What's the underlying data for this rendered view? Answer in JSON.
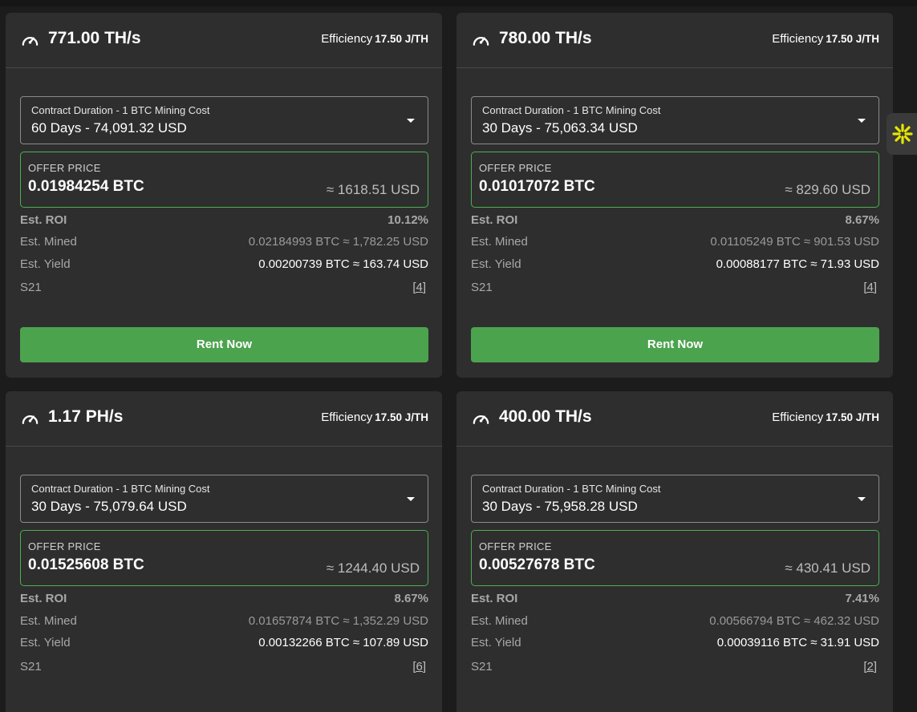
{
  "colors": {
    "accent_green": "#4ca34e",
    "card_bg": "#2e2e2e",
    "page_bg": "#1c1c1c",
    "widget_icon": "#e6e600"
  },
  "icons": {
    "hashrate": "speedometer-icon",
    "select": "caret-down-icon",
    "widget": "sparkle-icon"
  },
  "cards": [
    {
      "hashrate": "771.00 TH/s",
      "efficiency_label": "Efficiency",
      "efficiency_value": "17.50 J/TH",
      "select_label": "Contract Duration - 1 BTC Mining Cost",
      "select_value": "60 Days - 74,091.32 USD",
      "offer_label": "OFFER PRICE",
      "offer_btc": "0.01984254 BTC",
      "offer_usd": "≈ 1618.51 USD",
      "roi_label": "Est. ROI",
      "roi_value": "10.12%",
      "mined_label": "Est. Mined",
      "mined_value": "0.02184993 BTC ≈ 1,782.25 USD",
      "yield_label": "Est. Yield",
      "yield_value": "0.00200739 BTC ≈ 163.74 USD",
      "model": "S21",
      "model_count": "[4]",
      "button": "Rent Now"
    },
    {
      "hashrate": "780.00 TH/s",
      "efficiency_label": "Efficiency",
      "efficiency_value": "17.50 J/TH",
      "select_label": "Contract Duration - 1 BTC Mining Cost",
      "select_value": "30 Days - 75,063.34 USD",
      "offer_label": "OFFER PRICE",
      "offer_btc": "0.01017072 BTC",
      "offer_usd": "≈ 829.60 USD",
      "roi_label": "Est. ROI",
      "roi_value": "8.67%",
      "mined_label": "Est. Mined",
      "mined_value": "0.01105249 BTC ≈ 901.53 USD",
      "yield_label": "Est. Yield",
      "yield_value": "0.00088177 BTC ≈ 71.93 USD",
      "model": "S21",
      "model_count": "[4]",
      "button": "Rent Now"
    },
    {
      "hashrate": "1.17 PH/s",
      "efficiency_label": "Efficiency",
      "efficiency_value": "17.50 J/TH",
      "select_label": "Contract Duration - 1 BTC Mining Cost",
      "select_value": "30 Days - 75,079.64 USD",
      "offer_label": "OFFER PRICE",
      "offer_btc": "0.01525608 BTC",
      "offer_usd": "≈ 1244.40 USD",
      "roi_label": "Est. ROI",
      "roi_value": "8.67%",
      "mined_label": "Est. Mined",
      "mined_value": "0.01657874 BTC ≈ 1,352.29 USD",
      "yield_label": "Est. Yield",
      "yield_value": "0.00132266 BTC ≈ 107.89 USD",
      "model": "S21",
      "model_count": "[6]"
    },
    {
      "hashrate": "400.00 TH/s",
      "efficiency_label": "Efficiency",
      "efficiency_value": "17.50 J/TH",
      "select_label": "Contract Duration - 1 BTC Mining Cost",
      "select_value": "30 Days - 75,958.28 USD",
      "offer_label": "OFFER PRICE",
      "offer_btc": "0.00527678 BTC",
      "offer_usd": "≈ 430.41 USD",
      "roi_label": "Est. ROI",
      "roi_value": "7.41%",
      "mined_label": "Est. Mined",
      "mined_value": "0.00566794 BTC ≈ 462.32 USD",
      "yield_label": "Est. Yield",
      "yield_value": "0.00039116 BTC ≈ 31.91 USD",
      "model": "S21",
      "model_count": "[2]"
    }
  ]
}
